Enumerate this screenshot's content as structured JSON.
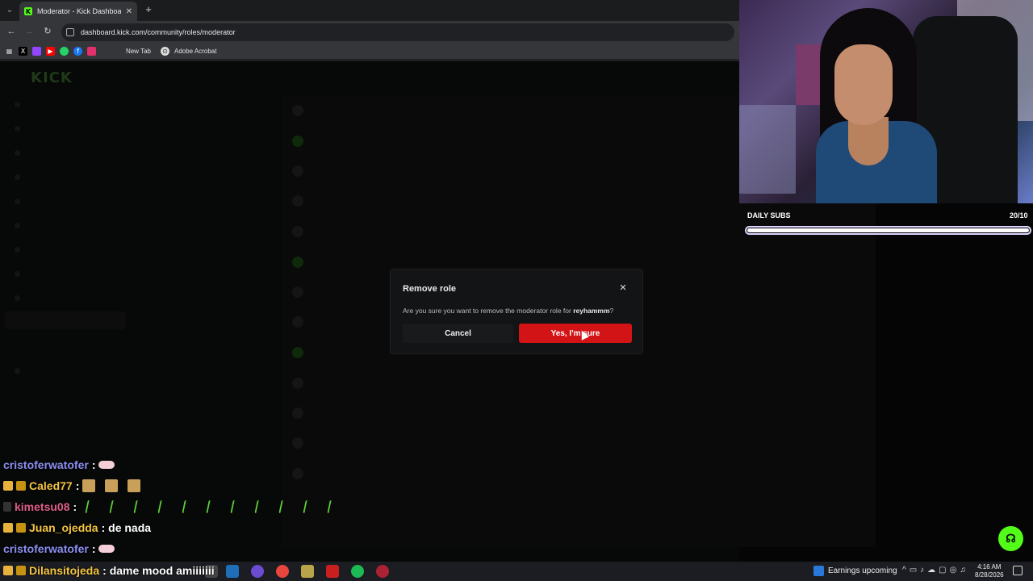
{
  "browser": {
    "tab_title": "Moderator - Kick Dashboard",
    "url": "dashboard.kick.com/community/roles/moderator",
    "bookmarks": [
      {
        "label": "New Tab"
      },
      {
        "label": "Adobe Acrobat"
      }
    ]
  },
  "modal": {
    "title": "Remove role",
    "message_prefix": "Are you sure you want to remove the moderator role for ",
    "username": "reyhammm",
    "message_suffix": "?",
    "cancel_label": "Cancel",
    "confirm_label": "Yes, I'm sure",
    "confirm_color": "#d21416"
  },
  "overlay": {
    "subs_label": "DAILY SUBS",
    "subs_count": "20/10",
    "subs_progress": 1.0
  },
  "chat": [
    {
      "user": "cristoferwatofer",
      "message": ": ",
      "color": "#8c8ff0"
    },
    {
      "user": "Caled77",
      "message": ": ",
      "color": "#f4c542"
    },
    {
      "user": "kimetsu08",
      "message": ": ",
      "color": "#e05e8a"
    },
    {
      "user": "Juan_ojedda",
      "message": ": de nada",
      "color": "#f4c542"
    },
    {
      "user": "cristoferwatofer",
      "message": ": ",
      "color": "#8c8ff0"
    },
    {
      "user": "Dilansitojeda",
      "message": ": dame mood amiiiiiii",
      "color": "#f4c542"
    }
  ],
  "taskbar": {
    "widget_label": "Earnings upcoming",
    "time": "4:16 AM",
    "date": "8/28/2026"
  },
  "colors": {
    "kick_green": "#53fc18",
    "danger": "#d21416"
  }
}
